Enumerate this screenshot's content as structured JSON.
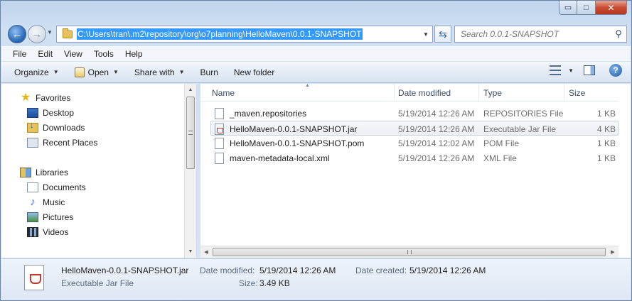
{
  "window": {
    "caption_buttons": {
      "minimize": "▭",
      "maximize": "□",
      "close": "✕"
    }
  },
  "nav": {
    "address_path": "C:\\Users\\tran\\.m2\\repository\\org\\o7planning\\HelloMaven\\0.0.1-SNAPSHOT",
    "search_placeholder": "Search 0.0.1-SNAPSHOT"
  },
  "menu": {
    "items": [
      "File",
      "Edit",
      "View",
      "Tools",
      "Help"
    ]
  },
  "toolbar": {
    "organize": "Organize",
    "open": "Open",
    "share_with": "Share with",
    "burn": "Burn",
    "new_folder": "New folder"
  },
  "sidebar": {
    "favorites": "Favorites",
    "favorites_items": [
      "Desktop",
      "Downloads",
      "Recent Places"
    ],
    "libraries": "Libraries",
    "libraries_items": [
      "Documents",
      "Music",
      "Pictures",
      "Videos"
    ]
  },
  "columns": {
    "name": "Name",
    "date": "Date modified",
    "type": "Type",
    "size": "Size"
  },
  "files": [
    {
      "name": "_maven.repositories",
      "date": "5/19/2014 12:26 AM",
      "type": "REPOSITORIES File",
      "size": "1 KB",
      "icon": "generic-file-icon"
    },
    {
      "name": "HelloMaven-0.0.1-SNAPSHOT.jar",
      "date": "5/19/2014 12:26 AM",
      "type": "Executable Jar File",
      "size": "4 KB",
      "icon": "jar-file-icon"
    },
    {
      "name": "HelloMaven-0.0.1-SNAPSHOT.pom",
      "date": "5/19/2014 12:02 AM",
      "type": "POM File",
      "size": "1 KB",
      "icon": "generic-file-icon"
    },
    {
      "name": "maven-metadata-local.xml",
      "date": "5/19/2014 12:26 AM",
      "type": "XML File",
      "size": "1 KB",
      "icon": "xml-file-icon"
    }
  ],
  "details": {
    "filename": "HelloMaven-0.0.1-SNAPSHOT.jar",
    "filetype": "Executable Jar File",
    "date_modified_label": "Date modified:",
    "date_modified": "5/19/2014 12:26 AM",
    "date_created_label": "Date created:",
    "date_created": "5/19/2014 12:26 AM",
    "size_label": "Size:",
    "size": "3.49 KB"
  }
}
